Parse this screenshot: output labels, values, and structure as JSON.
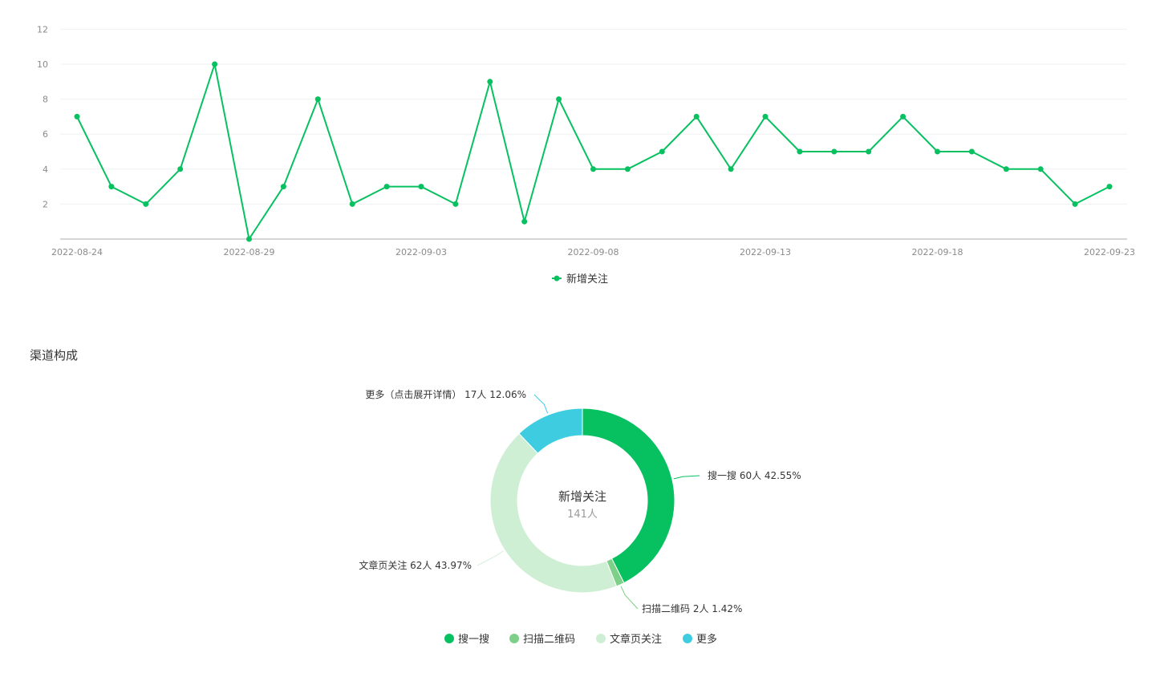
{
  "line_chart_legend": "新增关注",
  "channel_section_title": "渠道构成",
  "chart_data": [
    {
      "type": "line",
      "x": [
        "2022-08-24",
        "2022-08-25",
        "2022-08-26",
        "2022-08-27",
        "2022-08-28",
        "2022-08-29",
        "2022-08-30",
        "2022-08-31",
        "2022-09-01",
        "2022-09-02",
        "2022-09-03",
        "2022-09-04",
        "2022-09-05",
        "2022-09-06",
        "2022-09-07",
        "2022-09-08",
        "2022-09-09",
        "2022-09-10",
        "2022-09-11",
        "2022-09-12",
        "2022-09-13",
        "2022-09-14",
        "2022-09-15",
        "2022-09-16",
        "2022-09-17",
        "2022-09-18",
        "2022-09-19",
        "2022-09-20",
        "2022-09-21",
        "2022-09-22",
        "2022-09-23"
      ],
      "x_tick_labels": [
        "2022-08-24",
        "2022-08-29",
        "2022-09-03",
        "2022-09-08",
        "2022-09-13",
        "2022-09-18",
        "2022-09-23"
      ],
      "series": [
        {
          "name": "新增关注",
          "values": [
            7,
            3,
            2,
            4,
            10,
            0,
            3,
            8,
            2,
            3,
            3,
            2,
            9,
            1,
            8,
            4,
            4,
            5,
            7,
            4,
            7,
            5,
            5,
            5,
            7,
            5,
            5,
            4,
            4,
            2,
            3
          ],
          "color": "#07c160"
        }
      ],
      "ylim": [
        0,
        12
      ],
      "y_ticks": [
        2,
        4,
        6,
        8,
        10,
        12
      ],
      "grid": true,
      "legend_position": "bottom-center"
    },
    {
      "type": "pie",
      "donut": true,
      "center_title": "新增关注",
      "center_value": "141人",
      "slices": [
        {
          "name": "搜一搜",
          "label": "搜一搜 60人 42.55%",
          "value": 60,
          "percent": 42.55,
          "color": "#07c160"
        },
        {
          "name": "扫描二维码",
          "label": "扫描二维码 2人 1.42%",
          "value": 2,
          "percent": 1.42,
          "color": "#7dd088"
        },
        {
          "name": "文章页关注",
          "label": "文章页关注 62人 43.97%",
          "value": 62,
          "percent": 43.97,
          "color": "#cfefd4"
        },
        {
          "name": "更多",
          "label": "更多（点击展开详情） 17人 12.06%",
          "value": 17,
          "percent": 12.06,
          "color": "#3ecde0"
        }
      ],
      "legend_position": "bottom-center"
    }
  ]
}
